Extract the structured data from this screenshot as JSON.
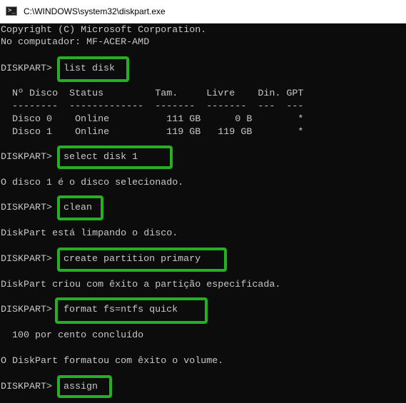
{
  "window": {
    "title": "C:\\WINDOWS\\system32\\diskpart.exe"
  },
  "console": {
    "copyright": "Copyright (C) Microsoft Corporation.",
    "computer": "No computador: MF-ACER-AMD",
    "prompt": "DISKPART> ",
    "commands": [
      "list disk",
      "select disk 1",
      "clean",
      "create partition primary",
      "format fs=ntfs quick",
      "assign"
    ],
    "disk_table": {
      "header": "  Nº Disco  Status         Tam.     Livre    Din. GPT",
      "separator": "  --------  -------------  -------  -------  ---  ---",
      "rows": [
        "  Disco 0    Online          111 GB      0 B        *",
        "  Disco 1    Online          119 GB   119 GB        *"
      ]
    },
    "messages": [
      "O disco 1 é o disco selecionado.",
      "DiskPart está limpando o disco.",
      "DiskPart criou com êxito a partição especificada.",
      "  100 por cento concluído",
      "O DiskPart formatou com êxito o volume."
    ]
  },
  "colors": {
    "console_background": "#0c0c0c",
    "console_text": "#c8c8c8",
    "highlight_box": "#23b123",
    "titlebar_background": "#ffffff"
  },
  "icons": {
    "app": "console-window-icon"
  }
}
